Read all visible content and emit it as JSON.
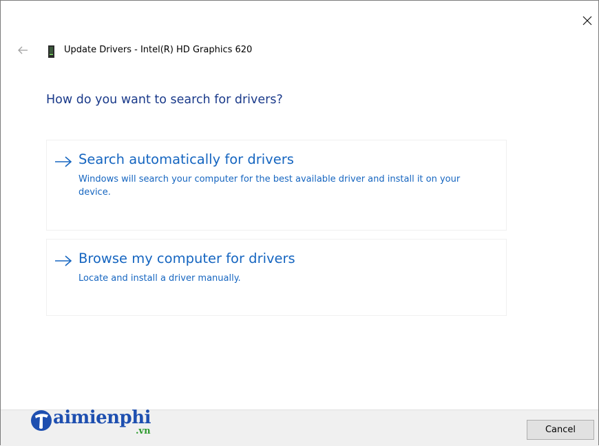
{
  "window": {
    "title": "Update Drivers - Intel(R) HD Graphics 620",
    "close_icon": "close-icon",
    "back_icon": "back-arrow-icon",
    "device_icon": "display-adapter-icon"
  },
  "main": {
    "heading": "How do you want to search for drivers?",
    "options": [
      {
        "title": "Search automatically for drivers",
        "description": "Windows will search your computer for the best available driver and install it on your device.",
        "icon": "right-arrow-icon"
      },
      {
        "title": "Browse my computer for drivers",
        "description": "Locate and install a driver manually.",
        "icon": "right-arrow-icon"
      }
    ]
  },
  "footer": {
    "cancel_label": "Cancel"
  },
  "watermark": {
    "brand": "aimienphi",
    "sub": ".vn"
  },
  "colors": {
    "heading": "#1a3a8a",
    "link": "#1565c0",
    "footer_bg": "#f0f0f0",
    "watermark_blue": "#1e4fb0",
    "watermark_green": "#2e9a2e"
  }
}
